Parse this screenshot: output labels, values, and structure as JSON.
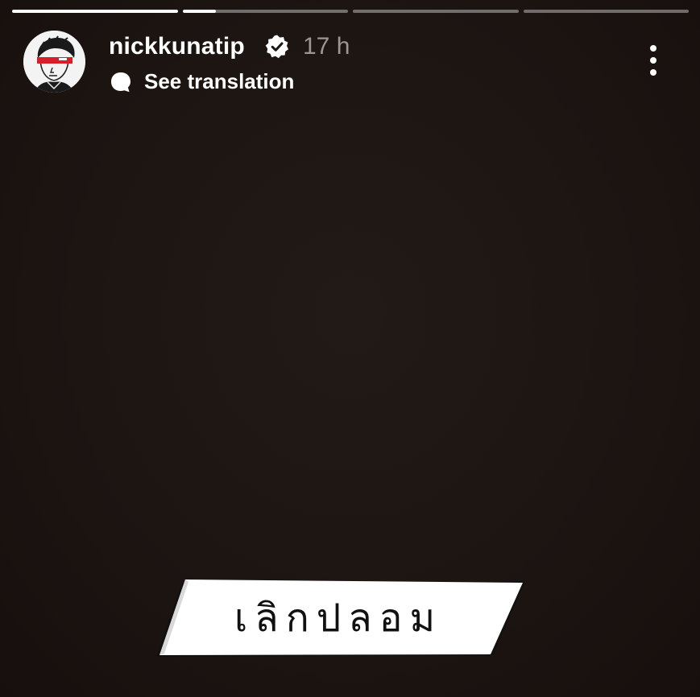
{
  "story": {
    "progress": [
      1.0,
      0.2,
      0.0,
      0.0
    ],
    "username": "nickkunatip",
    "verified": true,
    "timestamp": "17 h",
    "translation_label": "See translation",
    "caption_sticker": "เลิกปลอม"
  },
  "icons": {
    "verified": "verified-badge-icon",
    "translate": "speech-bubble-icon",
    "more": "more-vertical-icon"
  },
  "colors": {
    "background": "#1c1613",
    "timestamp": "#9d9793",
    "sticker_fill": "#ffffff",
    "avatar_accent": "#d61f26"
  }
}
